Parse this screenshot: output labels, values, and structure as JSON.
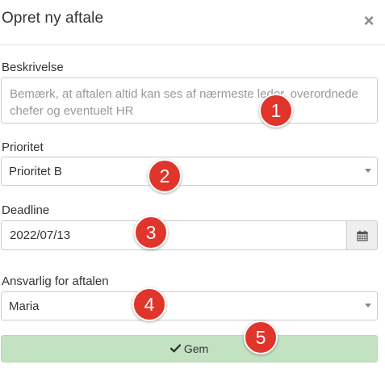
{
  "modal": {
    "title": "Opret ny aftale",
    "close_symbol": "×"
  },
  "description": {
    "label": "Beskrivelse",
    "placeholder": "Bemærk, at aftalen altid kan ses af nærmeste leder, overordnede chefer og eventuelt HR",
    "value": ""
  },
  "priority": {
    "label": "Prioritet",
    "selected": "Prioritet B"
  },
  "deadline": {
    "label": "Deadline",
    "value": "2022/07/13",
    "icon": "calendar-icon"
  },
  "responsible": {
    "label": "Ansvarlig for aftalen",
    "selected": "Maria"
  },
  "save_button": {
    "label": "Gem",
    "icon": "check-icon",
    "color": "#c2e2c2"
  },
  "annotations": {
    "color": "#e0352b",
    "badges": [
      "1",
      "2",
      "3",
      "4",
      "5"
    ]
  }
}
